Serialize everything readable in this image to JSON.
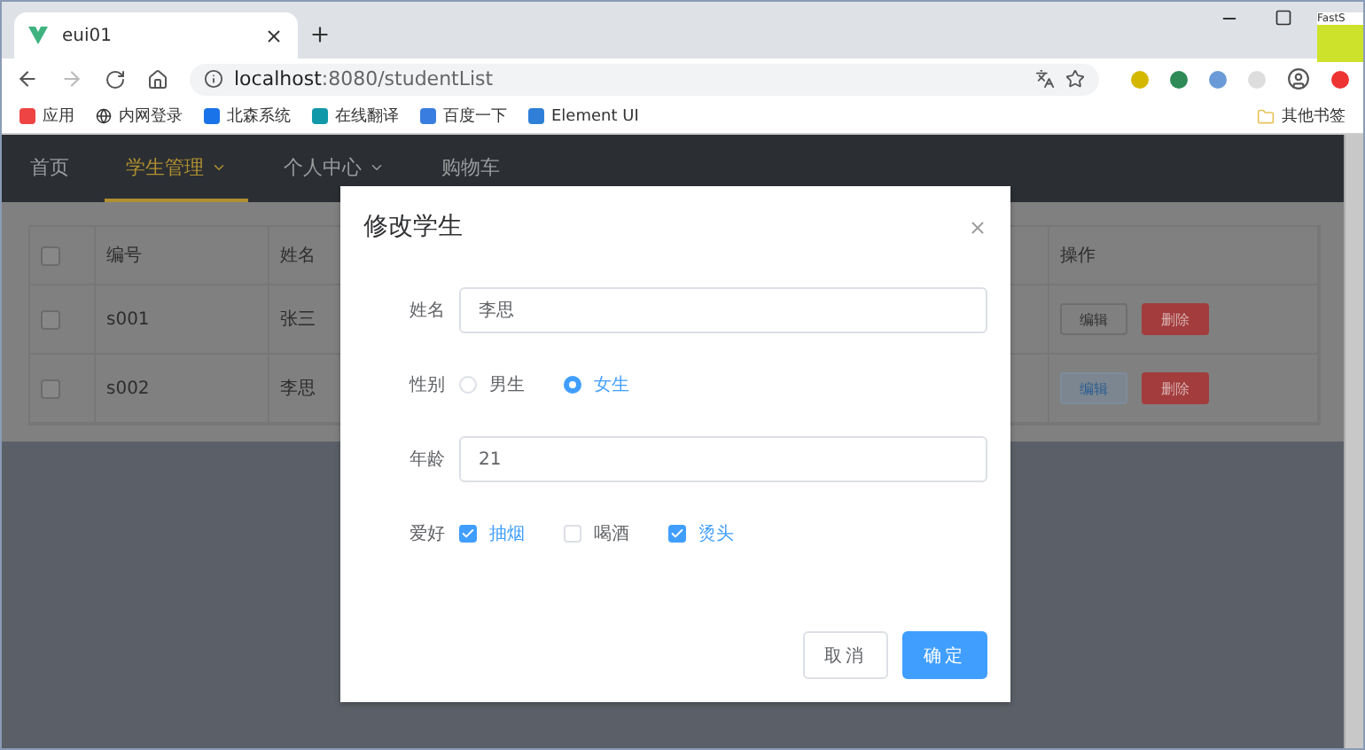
{
  "browser": {
    "tab": {
      "title": "eui01"
    },
    "url_host": "localhost",
    "url_path": ":8080/studentList",
    "bookmarks": [
      "应用",
      "内网登录",
      "北森系统",
      "在线翻译",
      "百度一下",
      "Element UI"
    ],
    "other_bookmarks": "其他书签",
    "capture_tool": "FastS"
  },
  "nav": [
    {
      "label": "首页",
      "selected": false,
      "dropdown": false
    },
    {
      "label": "学生管理",
      "selected": true,
      "dropdown": true
    },
    {
      "label": "个人中心",
      "selected": false,
      "dropdown": true
    },
    {
      "label": "购物车",
      "selected": false,
      "dropdown": false
    }
  ],
  "table": {
    "all_checked": false,
    "columns": [
      "编号",
      "姓名",
      "操作"
    ],
    "rows": [
      {
        "checked": false,
        "id": "s001",
        "name": "张三",
        "actions": [
          {
            "label": "编辑",
            "kind": "default"
          },
          {
            "label": "删除",
            "kind": "danger"
          }
        ]
      },
      {
        "checked": false,
        "id": "s002",
        "name": "李思",
        "actions": [
          {
            "label": "编辑",
            "kind": "focused"
          },
          {
            "label": "删除",
            "kind": "danger"
          }
        ]
      }
    ]
  },
  "dialog": {
    "title": "修改学生",
    "fields": [
      {
        "kind": "text",
        "label": "姓名",
        "value": "李思"
      },
      {
        "kind": "radio",
        "label": "性别",
        "options": [
          {
            "label": "男生",
            "selected": false
          },
          {
            "label": "女生",
            "selected": true
          }
        ]
      },
      {
        "kind": "text",
        "label": "年龄",
        "value": "21"
      },
      {
        "kind": "checkbox",
        "label": "爱好",
        "options": [
          {
            "label": "抽烟",
            "checked": true
          },
          {
            "label": "喝酒",
            "checked": false
          },
          {
            "label": "烫头",
            "checked": true
          }
        ]
      }
    ],
    "buttons": [
      {
        "label": "取消",
        "kind": "default"
      },
      {
        "label": "确定",
        "kind": "primary"
      }
    ]
  }
}
